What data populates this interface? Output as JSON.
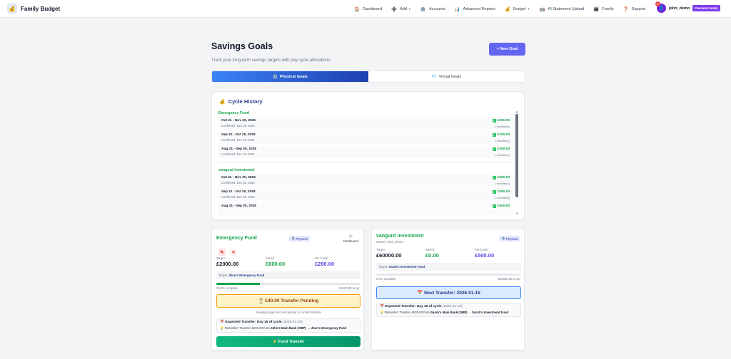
{
  "app": {
    "name": "Family Budget",
    "logo_icon": "wallet-icon"
  },
  "nav": {
    "items": [
      {
        "label": "Dashboard",
        "icon": "🏠"
      },
      {
        "label": "Add",
        "icon": "➕",
        "has_caret": true
      },
      {
        "label": "Accounts",
        "icon": "🏦"
      },
      {
        "label": "Advanced Reports",
        "icon": "📊"
      },
      {
        "label": "Budget",
        "icon": "💰",
        "has_caret": true
      },
      {
        "label": "AI Statement Upload",
        "icon": "🤖"
      },
      {
        "label": "Family",
        "icon": "👨‍👩‍👧"
      },
      {
        "label": "Support",
        "icon": "❓"
      }
    ],
    "user": {
      "name": "john_demo",
      "notification_count": "1",
      "badge": "Premium Family"
    }
  },
  "page": {
    "title": "Savings Goals",
    "subtitle": "Track your long-term savings targets with pay cycle allocations.",
    "new_goal_label": "+ New Goal"
  },
  "tabs": [
    {
      "label": "Physical Goals",
      "icon": "🏦",
      "active": true
    },
    {
      "label": "Virtual Goals",
      "icon": "💎",
      "active": false
    }
  ],
  "history": {
    "title": "Cycle History",
    "icon": "💰",
    "groups": [
      {
        "name": "Emergency Fund",
        "rows": [
          {
            "period": "Oct 21 - Nov 20, 2025",
            "confirmed": "Confirmed: Dec 28, 2025",
            "amount": "£200.00",
            "transfers": "1 transfer(s)"
          },
          {
            "period": "Sep 21 - Oct 20, 2025",
            "confirmed": "Confirmed: Dec 28, 2025",
            "amount": "£200.00",
            "transfers": "1 transfer(s)"
          },
          {
            "period": "Aug 21 - Sep 20, 2025",
            "confirmed": "Confirmed: Dec 28, 2025",
            "amount": "£200.00",
            "transfers": "1 transfer(s)"
          }
        ]
      },
      {
        "name": "vangurd investment",
        "rows": [
          {
            "period": "Oct 21 - Nov 20, 2025",
            "confirmed": "Confirmed: Dec 28, 2025",
            "amount": "£500.00",
            "transfers": "1 transfer(s)"
          },
          {
            "period": "Sep 21 - Oct 20, 2025",
            "confirmed": "Confirmed: Dec 28, 2025",
            "amount": "£500.00",
            "transfers": "1 transfer(s)"
          },
          {
            "period": "Aug 21 - Sep 20, 2025",
            "confirmed": "",
            "amount": "£500.00",
            "transfers": ""
          }
        ]
      }
    ]
  },
  "goals": [
    {
      "name": "Emergency Fund",
      "type": "Physical",
      "dashboard_label": "Dashboard",
      "target_label": "Target",
      "target_value": "£2000.00",
      "saved_label": "Saved",
      "saved_value": "£600.00",
      "per_cycle_label": "Per Cycle",
      "per_cycle_value": "£200.00",
      "target_account_prefix": "Target:",
      "target_account": "Jhon's Emergency Fund",
      "progress_fraction": 0.3,
      "progress_text": "30.0% complete",
      "remaining_text": "£1400.00 to go",
      "pending_label": "£40.00 Transfer Pending",
      "pending_icon": "⏳",
      "pending_note": "Awaiting target account upload to confirm transfer",
      "expected_label": "Expected Transfer: Day 15 of cycle",
      "expected_date": "(2026-01-15)",
      "reminder_prefix": "Reminder: Transfer £200.00 from",
      "reminder_source": "John's Main Bank (OBP)",
      "reminder_dest": "→ Jhon's Emergency Fund",
      "fund_button_label": "Fund Transfer",
      "fund_button_icon": "⚡"
    },
    {
      "name": "vangurd investment",
      "owner": "Owner: john_demo",
      "type": "Physical",
      "target_label": "Target",
      "target_value": "£60000.00",
      "saved_label": "Saved",
      "saved_value": "£0.00",
      "per_cycle_label": "Per Cycle",
      "per_cycle_value": "£500.00",
      "target_account_prefix": "Target:",
      "target_account": "Sarah's Investment Fund",
      "progress_fraction": 0.0,
      "progress_text": "0.0% complete",
      "remaining_text": "£60000.00 to go",
      "next_transfer_label": "Next Transfer: 2026-01-15",
      "next_transfer_icon": "📅",
      "expected_label": "Expected Transfer: Day 15 of cycle",
      "expected_date": "(2026-01-15)",
      "reminder_prefix": "Reminder: Transfer £500.00 from",
      "reminder_source": "Sarah's Main Bank (OBP)",
      "reminder_dest": "→ Sarah's Investment Fund"
    }
  ]
}
